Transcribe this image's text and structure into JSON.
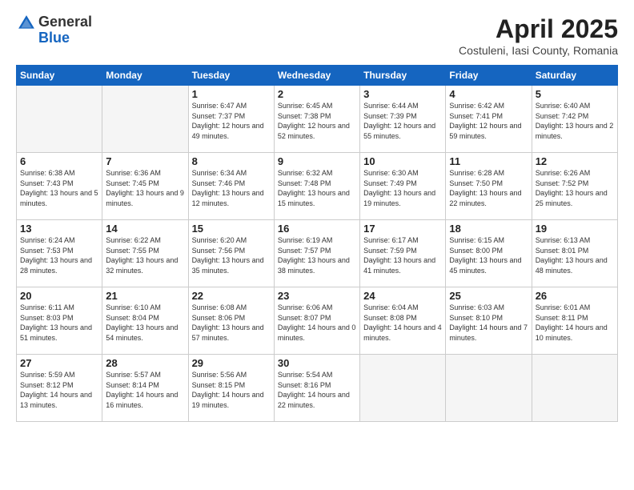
{
  "header": {
    "logo_general": "General",
    "logo_blue": "Blue",
    "title": "April 2025",
    "location": "Costuleni, Iasi County, Romania"
  },
  "weekdays": [
    "Sunday",
    "Monday",
    "Tuesday",
    "Wednesday",
    "Thursday",
    "Friday",
    "Saturday"
  ],
  "weeks": [
    [
      {
        "day": "",
        "empty": true
      },
      {
        "day": "",
        "empty": true
      },
      {
        "day": "1",
        "detail": "Sunrise: 6:47 AM\nSunset: 7:37 PM\nDaylight: 12 hours\nand 49 minutes."
      },
      {
        "day": "2",
        "detail": "Sunrise: 6:45 AM\nSunset: 7:38 PM\nDaylight: 12 hours\nand 52 minutes."
      },
      {
        "day": "3",
        "detail": "Sunrise: 6:44 AM\nSunset: 7:39 PM\nDaylight: 12 hours\nand 55 minutes."
      },
      {
        "day": "4",
        "detail": "Sunrise: 6:42 AM\nSunset: 7:41 PM\nDaylight: 12 hours\nand 59 minutes."
      },
      {
        "day": "5",
        "detail": "Sunrise: 6:40 AM\nSunset: 7:42 PM\nDaylight: 13 hours\nand 2 minutes."
      }
    ],
    [
      {
        "day": "6",
        "detail": "Sunrise: 6:38 AM\nSunset: 7:43 PM\nDaylight: 13 hours\nand 5 minutes."
      },
      {
        "day": "7",
        "detail": "Sunrise: 6:36 AM\nSunset: 7:45 PM\nDaylight: 13 hours\nand 9 minutes."
      },
      {
        "day": "8",
        "detail": "Sunrise: 6:34 AM\nSunset: 7:46 PM\nDaylight: 13 hours\nand 12 minutes."
      },
      {
        "day": "9",
        "detail": "Sunrise: 6:32 AM\nSunset: 7:48 PM\nDaylight: 13 hours\nand 15 minutes."
      },
      {
        "day": "10",
        "detail": "Sunrise: 6:30 AM\nSunset: 7:49 PM\nDaylight: 13 hours\nand 19 minutes."
      },
      {
        "day": "11",
        "detail": "Sunrise: 6:28 AM\nSunset: 7:50 PM\nDaylight: 13 hours\nand 22 minutes."
      },
      {
        "day": "12",
        "detail": "Sunrise: 6:26 AM\nSunset: 7:52 PM\nDaylight: 13 hours\nand 25 minutes."
      }
    ],
    [
      {
        "day": "13",
        "detail": "Sunrise: 6:24 AM\nSunset: 7:53 PM\nDaylight: 13 hours\nand 28 minutes."
      },
      {
        "day": "14",
        "detail": "Sunrise: 6:22 AM\nSunset: 7:55 PM\nDaylight: 13 hours\nand 32 minutes."
      },
      {
        "day": "15",
        "detail": "Sunrise: 6:20 AM\nSunset: 7:56 PM\nDaylight: 13 hours\nand 35 minutes."
      },
      {
        "day": "16",
        "detail": "Sunrise: 6:19 AM\nSunset: 7:57 PM\nDaylight: 13 hours\nand 38 minutes."
      },
      {
        "day": "17",
        "detail": "Sunrise: 6:17 AM\nSunset: 7:59 PM\nDaylight: 13 hours\nand 41 minutes."
      },
      {
        "day": "18",
        "detail": "Sunrise: 6:15 AM\nSunset: 8:00 PM\nDaylight: 13 hours\nand 45 minutes."
      },
      {
        "day": "19",
        "detail": "Sunrise: 6:13 AM\nSunset: 8:01 PM\nDaylight: 13 hours\nand 48 minutes."
      }
    ],
    [
      {
        "day": "20",
        "detail": "Sunrise: 6:11 AM\nSunset: 8:03 PM\nDaylight: 13 hours\nand 51 minutes."
      },
      {
        "day": "21",
        "detail": "Sunrise: 6:10 AM\nSunset: 8:04 PM\nDaylight: 13 hours\nand 54 minutes."
      },
      {
        "day": "22",
        "detail": "Sunrise: 6:08 AM\nSunset: 8:06 PM\nDaylight: 13 hours\nand 57 minutes."
      },
      {
        "day": "23",
        "detail": "Sunrise: 6:06 AM\nSunset: 8:07 PM\nDaylight: 14 hours\nand 0 minutes."
      },
      {
        "day": "24",
        "detail": "Sunrise: 6:04 AM\nSunset: 8:08 PM\nDaylight: 14 hours\nand 4 minutes."
      },
      {
        "day": "25",
        "detail": "Sunrise: 6:03 AM\nSunset: 8:10 PM\nDaylight: 14 hours\nand 7 minutes."
      },
      {
        "day": "26",
        "detail": "Sunrise: 6:01 AM\nSunset: 8:11 PM\nDaylight: 14 hours\nand 10 minutes."
      }
    ],
    [
      {
        "day": "27",
        "detail": "Sunrise: 5:59 AM\nSunset: 8:12 PM\nDaylight: 14 hours\nand 13 minutes."
      },
      {
        "day": "28",
        "detail": "Sunrise: 5:57 AM\nSunset: 8:14 PM\nDaylight: 14 hours\nand 16 minutes."
      },
      {
        "day": "29",
        "detail": "Sunrise: 5:56 AM\nSunset: 8:15 PM\nDaylight: 14 hours\nand 19 minutes."
      },
      {
        "day": "30",
        "detail": "Sunrise: 5:54 AM\nSunset: 8:16 PM\nDaylight: 14 hours\nand 22 minutes."
      },
      {
        "day": "",
        "empty": true
      },
      {
        "day": "",
        "empty": true
      },
      {
        "day": "",
        "empty": true
      }
    ]
  ]
}
